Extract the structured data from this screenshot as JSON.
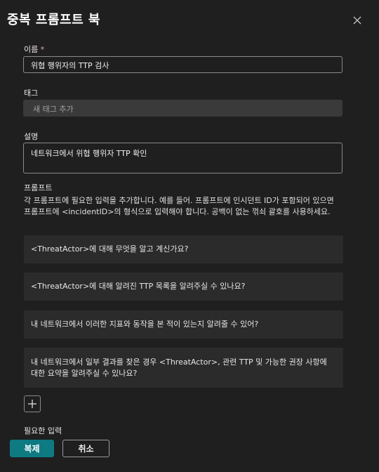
{
  "dialog": {
    "title": "중복 프롬프트 북",
    "close_icon": "close-icon"
  },
  "name_field": {
    "label": "이름",
    "required_marker": "*",
    "value": "위협 행위자의 TTP 검사"
  },
  "tags_field": {
    "label": "태그",
    "placeholder": "새 태그 추가"
  },
  "description_field": {
    "label": "설명",
    "value": "네트워크에서 위협 행위자 TTP 확인"
  },
  "prompts": {
    "label": "프롬프트",
    "help_text": "각 프롬프트에 필요한 입력을 추가합니다. 예를 들어. 프롬프트에 인시던트 ID가 포함되어 있으면 프롬프트에 <incidentID>의 형식으로 입력해야 합니다. 공백이 없는 꺾쇠 괄호를 사용하세요.",
    "items": [
      {
        "text": "<ThreatActor>에 대해 무엇을 알고 계신가요?"
      },
      {
        "text": "<ThreatActor>에 대해 알려진 TTP 목록을 알려주실 수 있나요?"
      },
      {
        "text": "내 네트워크에서 이러한 지표와 동작을 본 적이 있는지 알려줄 수 있어?"
      },
      {
        "text": "내 네트워크에서 일부 결과를 찾은 경우 <ThreatActor>, 관련 TTP 및 가능한 권장 사항에 대한 요약을 알려주실 수 있나요?"
      }
    ],
    "add_icon": "plus-icon"
  },
  "required_inputs": {
    "label": "필요한 입력"
  },
  "footer": {
    "duplicate_label": "복제",
    "cancel_label": "취소"
  },
  "colors": {
    "background": "#1f1f1f",
    "primary_button": "#0e7a82",
    "prompt_background": "#2b2b2b"
  }
}
